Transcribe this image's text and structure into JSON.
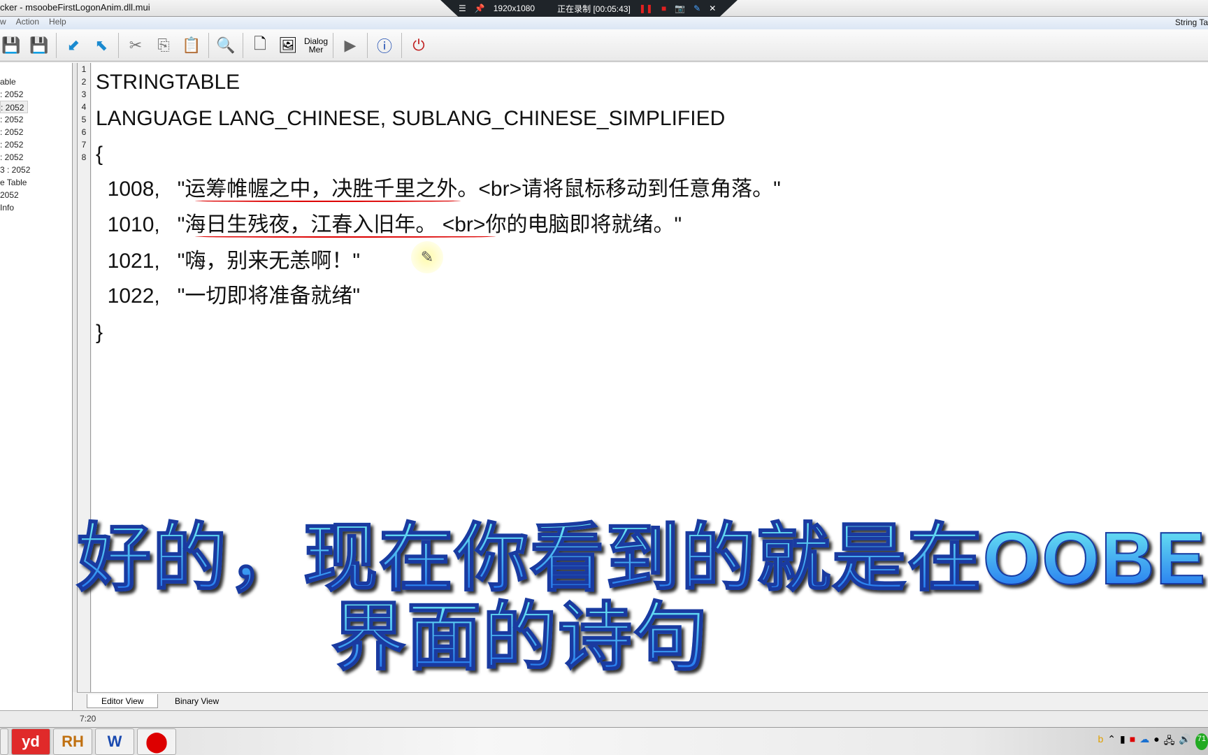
{
  "title": "cker - msoobeFirstLogonAnim.dll.mui",
  "recorder": {
    "resolution": "1920x1080",
    "status": "正在录制 [00:05:43]"
  },
  "menu": [
    "w",
    "Action",
    "Help"
  ],
  "menu_right": "String Ta",
  "toolbar": {
    "dialog_menu_label_1": "Dialog",
    "dialog_menu_label_2": "Mer"
  },
  "tree": [
    "able",
    ": 2052",
    ": 2052",
    ": 2052",
    ": 2052",
    ": 2052",
    ": 2052",
    "3 : 2052",
    "e Table",
    " 2052",
    " Info"
  ],
  "line_numbers": [
    "1",
    "2",
    "3",
    "4",
    "5",
    "6",
    "7",
    "8"
  ],
  "code": [
    "STRINGTABLE",
    "LANGUAGE LANG_CHINESE, SUBLANG_CHINESE_SIMPLIFIED",
    "{",
    "  1008,   \"运筹帷幄之中，决胜千里之外。<br>请将鼠标移动到任意角落。\"",
    "  1010,   \"海日生残夜，江春入旧年。 <br>你的电脑即将就绪。\"",
    "  1021,   \"嗨，别来无恙啊！\"",
    "  1022,   \"一切即将准备就绪\"",
    "}"
  ],
  "caption": [
    "好的，现在你看到的就是在OOBE",
    "界面的诗句"
  ],
  "tabs": [
    "Editor View",
    "Binary View"
  ],
  "status": "7:20",
  "taskbar": [
    "yd",
    "RH",
    "W"
  ],
  "tray_badge": "71"
}
